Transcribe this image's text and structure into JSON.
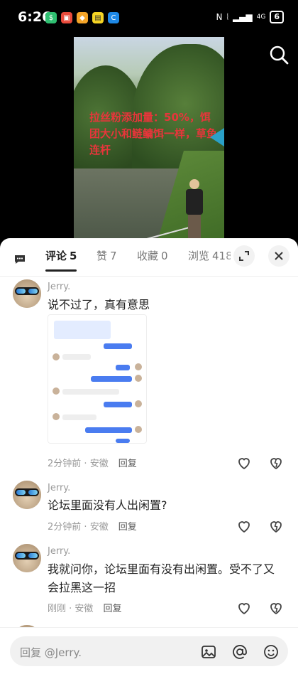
{
  "status_bar": {
    "time": "6:26",
    "battery": "6",
    "network": "4G"
  },
  "video": {
    "overlay_text": "拉丝粉添加量：50%，饵团大小和鲢鳙饵一样，草鱼连杆"
  },
  "tabs": [
    {
      "label": "评论",
      "count": "5"
    },
    {
      "label": "赞",
      "count": "7"
    },
    {
      "label": "收藏",
      "count": "0"
    },
    {
      "label": "浏览",
      "count": "418"
    }
  ],
  "comments": [
    {
      "username": "Jerry.",
      "text": "说不过了，真有意思",
      "time": "2分钟前",
      "location": "安徽",
      "reply_label": "回复"
    },
    {
      "username": "Jerry.",
      "text": "论坛里面没有人出闲置?",
      "time": "2分钟前",
      "location": "安徽",
      "reply_label": "回复"
    },
    {
      "username": "Jerry.",
      "text": "我就问你，论坛里面有没有出闲置。受不了又会拉黑这一招",
      "time": "刚刚",
      "location": "安徽",
      "reply_label": "回复"
    }
  ],
  "input": {
    "placeholder": "回复 @Jerry."
  },
  "colors": {
    "overlay_text": "#e8353b",
    "tab_active": "#222222",
    "chat_bubble": "#4a7cf0"
  },
  "icons": [
    "search-icon",
    "comment-menu-icon",
    "expand-icon",
    "close-icon",
    "heart-icon",
    "dislike-icon",
    "image-icon",
    "at-icon",
    "emoji-icon"
  ]
}
